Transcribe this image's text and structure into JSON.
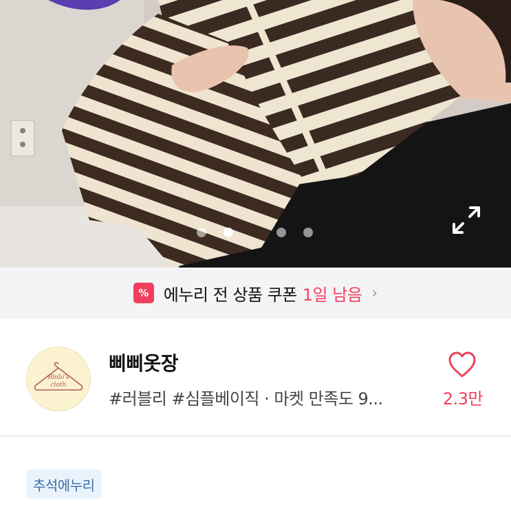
{
  "product_image": {
    "alt": "",
    "expand_icon": "expand-icon",
    "carousel": {
      "total": 4,
      "active_index": 1
    }
  },
  "coupon_banner": {
    "icon": "coupon-icon",
    "icon_glyph": "%",
    "text": "에누리 전 상품 쿠폰",
    "highlight": "1일 남음",
    "chevron": "›",
    "colors": {
      "accent": "#f0405e",
      "background": "#f4f4f6"
    }
  },
  "shop": {
    "name": "삐삐옷장",
    "tags": "#러블리 #심플베이직 · 마켓 만족도 9...",
    "logo_text_line1": "Bbibi's",
    "logo_text_line2": "cloth",
    "like_icon": "heart-icon",
    "like_count": "2.3만"
  },
  "badge": {
    "label": "추석에누리",
    "colors": {
      "background": "#eaf3fc",
      "text": "#3a6ea8"
    }
  }
}
